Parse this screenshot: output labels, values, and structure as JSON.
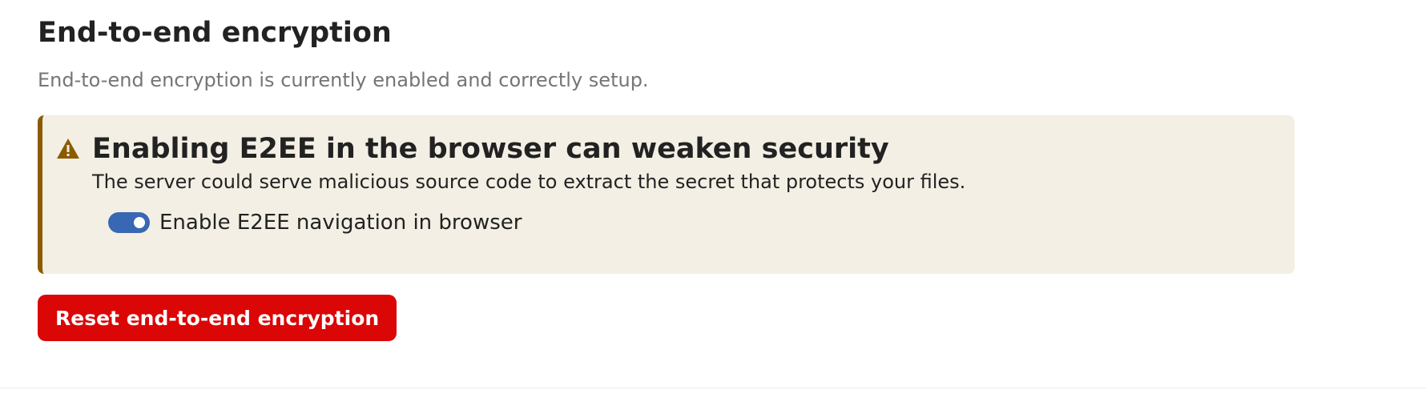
{
  "section": {
    "title": "End-to-end encryption",
    "description": "End-to-end encryption is currently enabled and correctly setup."
  },
  "warning": {
    "icon": "warning-icon",
    "accent_color": "#8a5b00",
    "background_color": "#f3efe4",
    "heading": "Enabling E2EE in the browser can weaken security",
    "text": "The server could serve malicious source code to extract the secret that protects your files."
  },
  "toggle": {
    "label": "Enable E2EE navigation in browser",
    "checked": true,
    "color": "#3867b3"
  },
  "reset_button": {
    "label": "Reset end-to-end encryption",
    "color": "#db0606"
  }
}
